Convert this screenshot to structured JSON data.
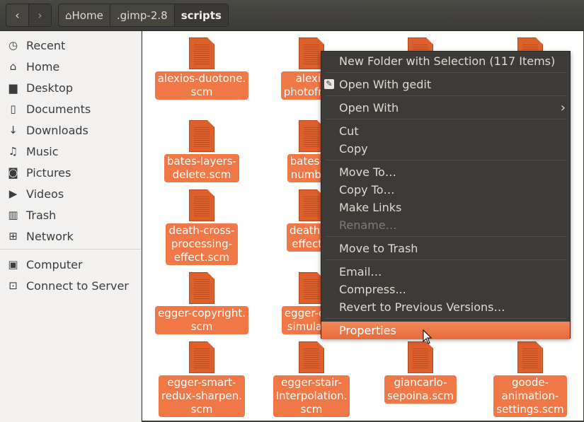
{
  "nav": {
    "back": "‹",
    "forward": "›"
  },
  "breadcrumbs": [
    "⌂Home",
    ".gimp-2.8",
    "scripts"
  ],
  "sidebar": {
    "items": [
      {
        "icon": "clock-icon",
        "glyph": "◷",
        "label": "Recent"
      },
      {
        "icon": "home-icon",
        "glyph": "⌂",
        "label": "Home"
      },
      {
        "icon": "folder-icon",
        "glyph": "▆",
        "label": "Desktop"
      },
      {
        "icon": "document-icon",
        "glyph": "▯",
        "label": "Documents"
      },
      {
        "icon": "download-icon",
        "glyph": "↓",
        "label": "Downloads"
      },
      {
        "icon": "music-icon",
        "glyph": "♫",
        "label": "Music"
      },
      {
        "icon": "camera-icon",
        "glyph": "◙",
        "label": "Pictures"
      },
      {
        "icon": "video-icon",
        "glyph": "▶",
        "label": "Videos"
      },
      {
        "icon": "trash-icon",
        "glyph": "▥",
        "label": "Trash"
      },
      {
        "icon": "network-icon",
        "glyph": "⊞",
        "label": "Network"
      },
      {
        "icon": "computer-icon",
        "glyph": "▣",
        "label": "Computer"
      },
      {
        "icon": "server-icon",
        "glyph": "⊡",
        "label": "Connect to Server"
      }
    ]
  },
  "files": [
    {
      "label": "alexios-duotone.\nscm"
    },
    {
      "label": "alexio\nphotofram"
    },
    {
      "label": ""
    },
    {
      "label": ""
    },
    {
      "label": "bates-layers-\ndelete.scm"
    },
    {
      "label": "bates-la\nnumber"
    },
    {
      "label": ""
    },
    {
      "label": ""
    },
    {
      "label": "death-cross-\nprocessing-\neffect.scm"
    },
    {
      "label": "death-lo\neffect.s"
    },
    {
      "label": ""
    },
    {
      "label": ""
    },
    {
      "label": "egger-copyright.\nscm"
    },
    {
      "label": "egger-duo\nsimulatio"
    },
    {
      "label": ""
    },
    {
      "label": ""
    },
    {
      "label": "egger-smart-\nredux-sharpen.\nscm"
    },
    {
      "label": "egger-stair-\nInterpolation.\nscm"
    },
    {
      "label": "giancarlo-\nsepoina.scm"
    },
    {
      "label": "goode-\nanimation-\nsettings.scm"
    }
  ],
  "context_menu": {
    "items": [
      {
        "label": "New Folder with Selection (117 Items)"
      },
      {
        "label": "Open With gedit",
        "icon": "gedit-icon"
      },
      {
        "label": "Open With",
        "submenu": "›"
      },
      {
        "label": "Cut"
      },
      {
        "label": "Copy"
      },
      {
        "label": "Move To…"
      },
      {
        "label": "Copy To…"
      },
      {
        "label": "Make Links"
      },
      {
        "label": "Rename…",
        "disabled": true
      },
      {
        "label": "Move to Trash"
      },
      {
        "label": "Email…"
      },
      {
        "label": "Compress..."
      },
      {
        "label": "Revert to Previous Versions…"
      },
      {
        "label": "Properties",
        "highlighted": true
      }
    ]
  },
  "colors": {
    "accent": "#f07746",
    "header": "#3c3b37",
    "sidebar": "#f2f1f0"
  }
}
